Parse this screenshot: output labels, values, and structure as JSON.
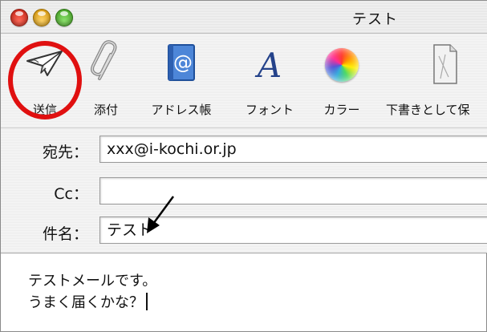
{
  "window": {
    "title": "テスト"
  },
  "toolbar": {
    "send_label": "送信",
    "attach_label": "添付",
    "address_label": "アドレス帳",
    "font_label": "フォント",
    "color_label": "カラー",
    "draft_label": "下書きとして保"
  },
  "headers": {
    "to_label": "宛先：",
    "to_value": "xxx@i-kochi.or.jp",
    "cc_label": "Cc：",
    "cc_value": "",
    "subject_label": "件名：",
    "subject_value": "テスト"
  },
  "message": {
    "line1": "テストメールです。",
    "line2": "うまく届くかな？"
  },
  "colors": {
    "highlight_ring": "#e01010"
  }
}
